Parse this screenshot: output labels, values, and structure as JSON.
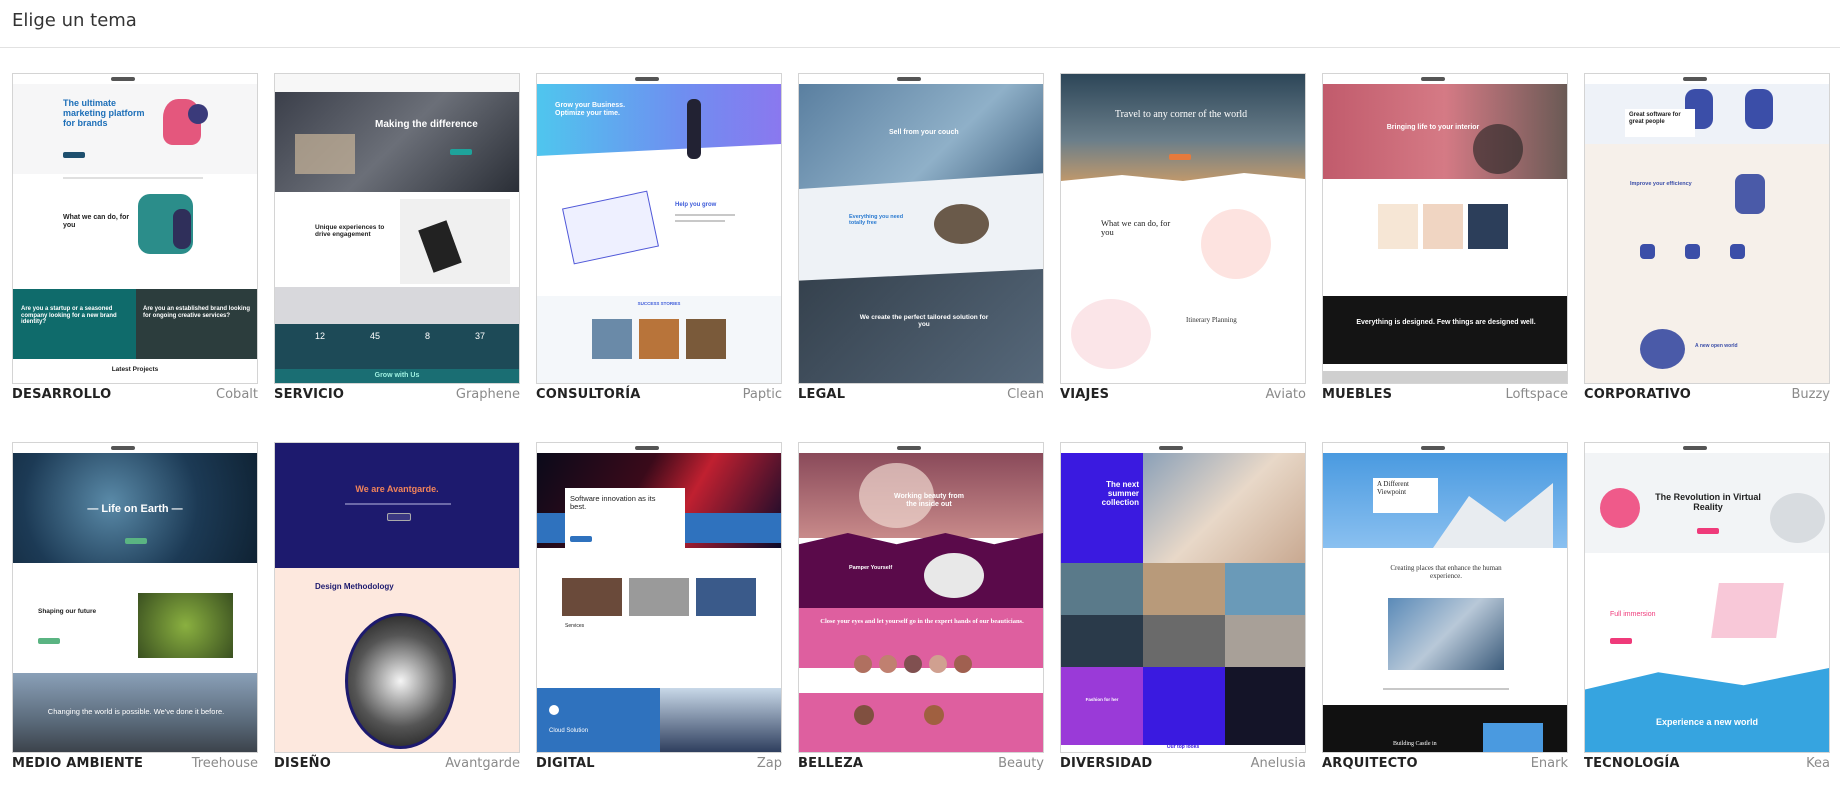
{
  "header": {
    "title": "Elige un tema"
  },
  "themes": [
    {
      "category": "DESARROLLO",
      "name": "Cobalt",
      "hero": "The ultimate marketing platform for brands",
      "sub": "What we can do, for you",
      "panel1": "Are you a startup or a seasoned company looking for a new brand identity?",
      "panel2": "Are you an established brand looking for ongoing creative services?",
      "footer": "Latest Projects"
    },
    {
      "category": "SERVICIO",
      "name": "Graphene",
      "hero": "Making the difference",
      "sub": "Unique experiences to drive engagement",
      "stats": [
        "12",
        "45",
        "8",
        "37"
      ],
      "footer": "Grow with Us"
    },
    {
      "category": "CONSULTORÍA",
      "name": "Paptic",
      "hero": "Grow your Business. Optimize your time.",
      "sub": "Help you grow",
      "footer": "SUCCESS STORIES"
    },
    {
      "category": "LEGAL",
      "name": "Clean",
      "hero": "Sell from your couch",
      "sub": "Everything you need totally free",
      "footer": "We create the perfect tailored solution for you"
    },
    {
      "category": "VIAJES",
      "name": "Aviato",
      "hero": "Travel to any corner of the world",
      "sub": "What we can do, for you",
      "footer": "Itinerary Planning"
    },
    {
      "category": "MUEBLES",
      "name": "Loftspace",
      "hero": "Bringing life to your interior",
      "sub": "Everything is designed. Few things are designed well.",
      "footer": ""
    },
    {
      "category": "CORPORATIVO",
      "name": "Buzzy",
      "hero": "Great software for great people",
      "sub": "Improve your efficiency",
      "footer": "A new open world"
    },
    {
      "category": "MEDIO AMBIENTE",
      "name": "Treehouse",
      "hero": "— Life on Earth —",
      "sub": "Shaping our future",
      "footer": "Changing the world is possible. We've done it before."
    },
    {
      "category": "DISEÑO",
      "name": "Avantgarde",
      "hero": "We are Avantgarde.",
      "sub": "Design Methodology",
      "footer": ""
    },
    {
      "category": "DIGITAL",
      "name": "Zap",
      "hero": "Software innovation as its best.",
      "sub": "Services",
      "footer": "Cloud Solution"
    },
    {
      "category": "BELLEZA",
      "name": "Beauty",
      "hero": "Working beauty from the inside out",
      "sub": "Pamper Yourself",
      "footer": "Close your eyes and let yourself go in the expert hands of our beauticians."
    },
    {
      "category": "DIVERSIDAD",
      "name": "Anelusia",
      "hero": "The next summer collection",
      "sub": "Fashion for her",
      "footer": "Our top looks"
    },
    {
      "category": "ARQUITECTO",
      "name": "Enark",
      "hero": "A Different Viewpoint",
      "sub": "Creating places that enhance the human experience.",
      "footer": "Building Castle in"
    },
    {
      "category": "TECNOLOGÍA",
      "name": "Kea",
      "hero": "The Revolution in Virtual Reality",
      "sub": "Full immersion",
      "footer": "Experience a new world"
    }
  ]
}
